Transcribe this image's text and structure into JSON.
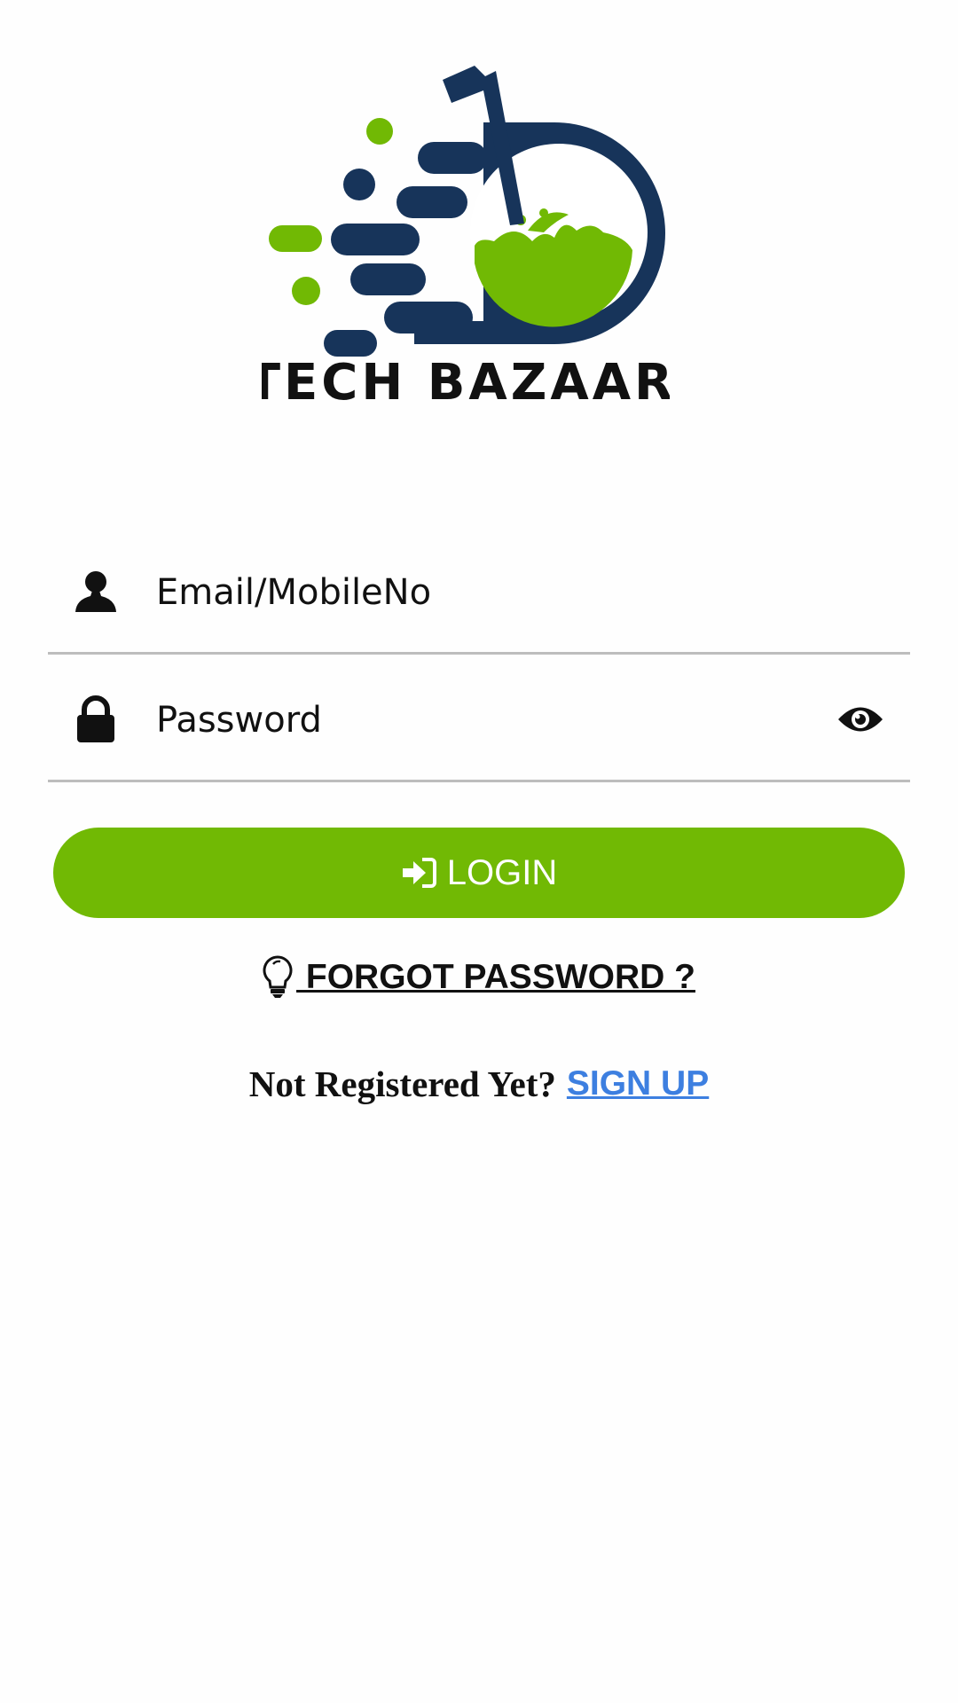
{
  "brand": {
    "name": "TECH BAZAAR",
    "colors": {
      "navy": "#17345a",
      "green": "#71b904"
    }
  },
  "form": {
    "email": {
      "placeholder": "Email/MobileNo",
      "value": "",
      "icon": "user-icon"
    },
    "password": {
      "placeholder": "Password",
      "value": "",
      "icon": "lock-icon",
      "toggle_icon": "eye-icon"
    }
  },
  "login_button": {
    "label": "LOGIN",
    "icon": "sign-in-icon",
    "color": "#71b904"
  },
  "forgot_password": {
    "label": " FORGOT PASSWORD ?",
    "icon": "lightbulb-icon"
  },
  "signup": {
    "prompt": "Not Registered Yet?",
    "link": "SIGN UP",
    "link_color": "#3d7fe0"
  }
}
